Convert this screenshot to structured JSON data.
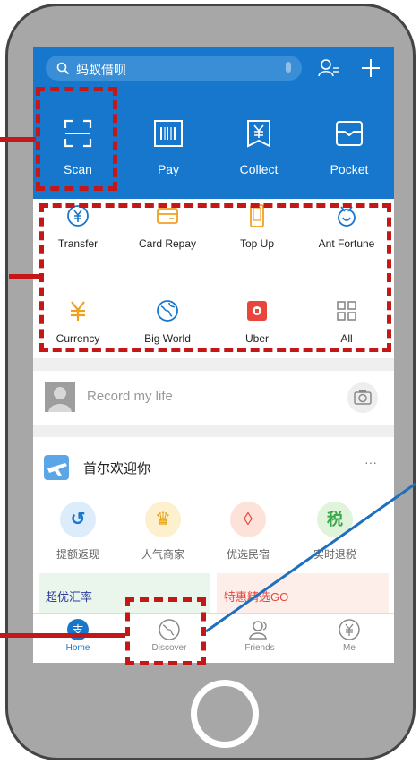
{
  "search": {
    "placeholder": "蚂蚁借呗"
  },
  "top_actions": [
    {
      "label": "Scan",
      "icon": "scan-icon"
    },
    {
      "label": "Pay",
      "icon": "barcode-icon"
    },
    {
      "label": "Collect",
      "icon": "yuan-receive-icon"
    },
    {
      "label": "Pocket",
      "icon": "card-pocket-icon"
    }
  ],
  "services": [
    {
      "label": "Transfer",
      "icon": "yuan-circle-icon"
    },
    {
      "label": "Card Repay",
      "icon": "credit-card-icon"
    },
    {
      "label": "Top Up",
      "icon": "phone-icon"
    },
    {
      "label": "Ant Fortune",
      "icon": "fortune-icon"
    },
    {
      "label": "Currency",
      "icon": "yen-icon"
    },
    {
      "label": "Big World",
      "icon": "globe-icon"
    },
    {
      "label": "Uber",
      "icon": "uber-icon"
    },
    {
      "label": "All",
      "icon": "grid-icon"
    }
  ],
  "record": {
    "placeholder": "Record my life"
  },
  "card": {
    "title": "首尔欢迎你",
    "more": "···",
    "items": [
      {
        "label": "提额返现"
      },
      {
        "label": "人气商家"
      },
      {
        "label": "优选民宿"
      },
      {
        "label": "实时退税"
      }
    ],
    "promo_left": "超优汇率",
    "promo_right": "特惠精选GO"
  },
  "tabbar": [
    {
      "label": "Home",
      "icon": "home-icon"
    },
    {
      "label": "Discover",
      "icon": "discover-icon"
    },
    {
      "label": "Friends",
      "icon": "friends-icon"
    },
    {
      "label": "Me",
      "icon": "yuan-me-icon"
    }
  ],
  "colors": {
    "accent": "#1677cc",
    "annotation": "#c41818",
    "pointer": "#1e6fc0"
  }
}
